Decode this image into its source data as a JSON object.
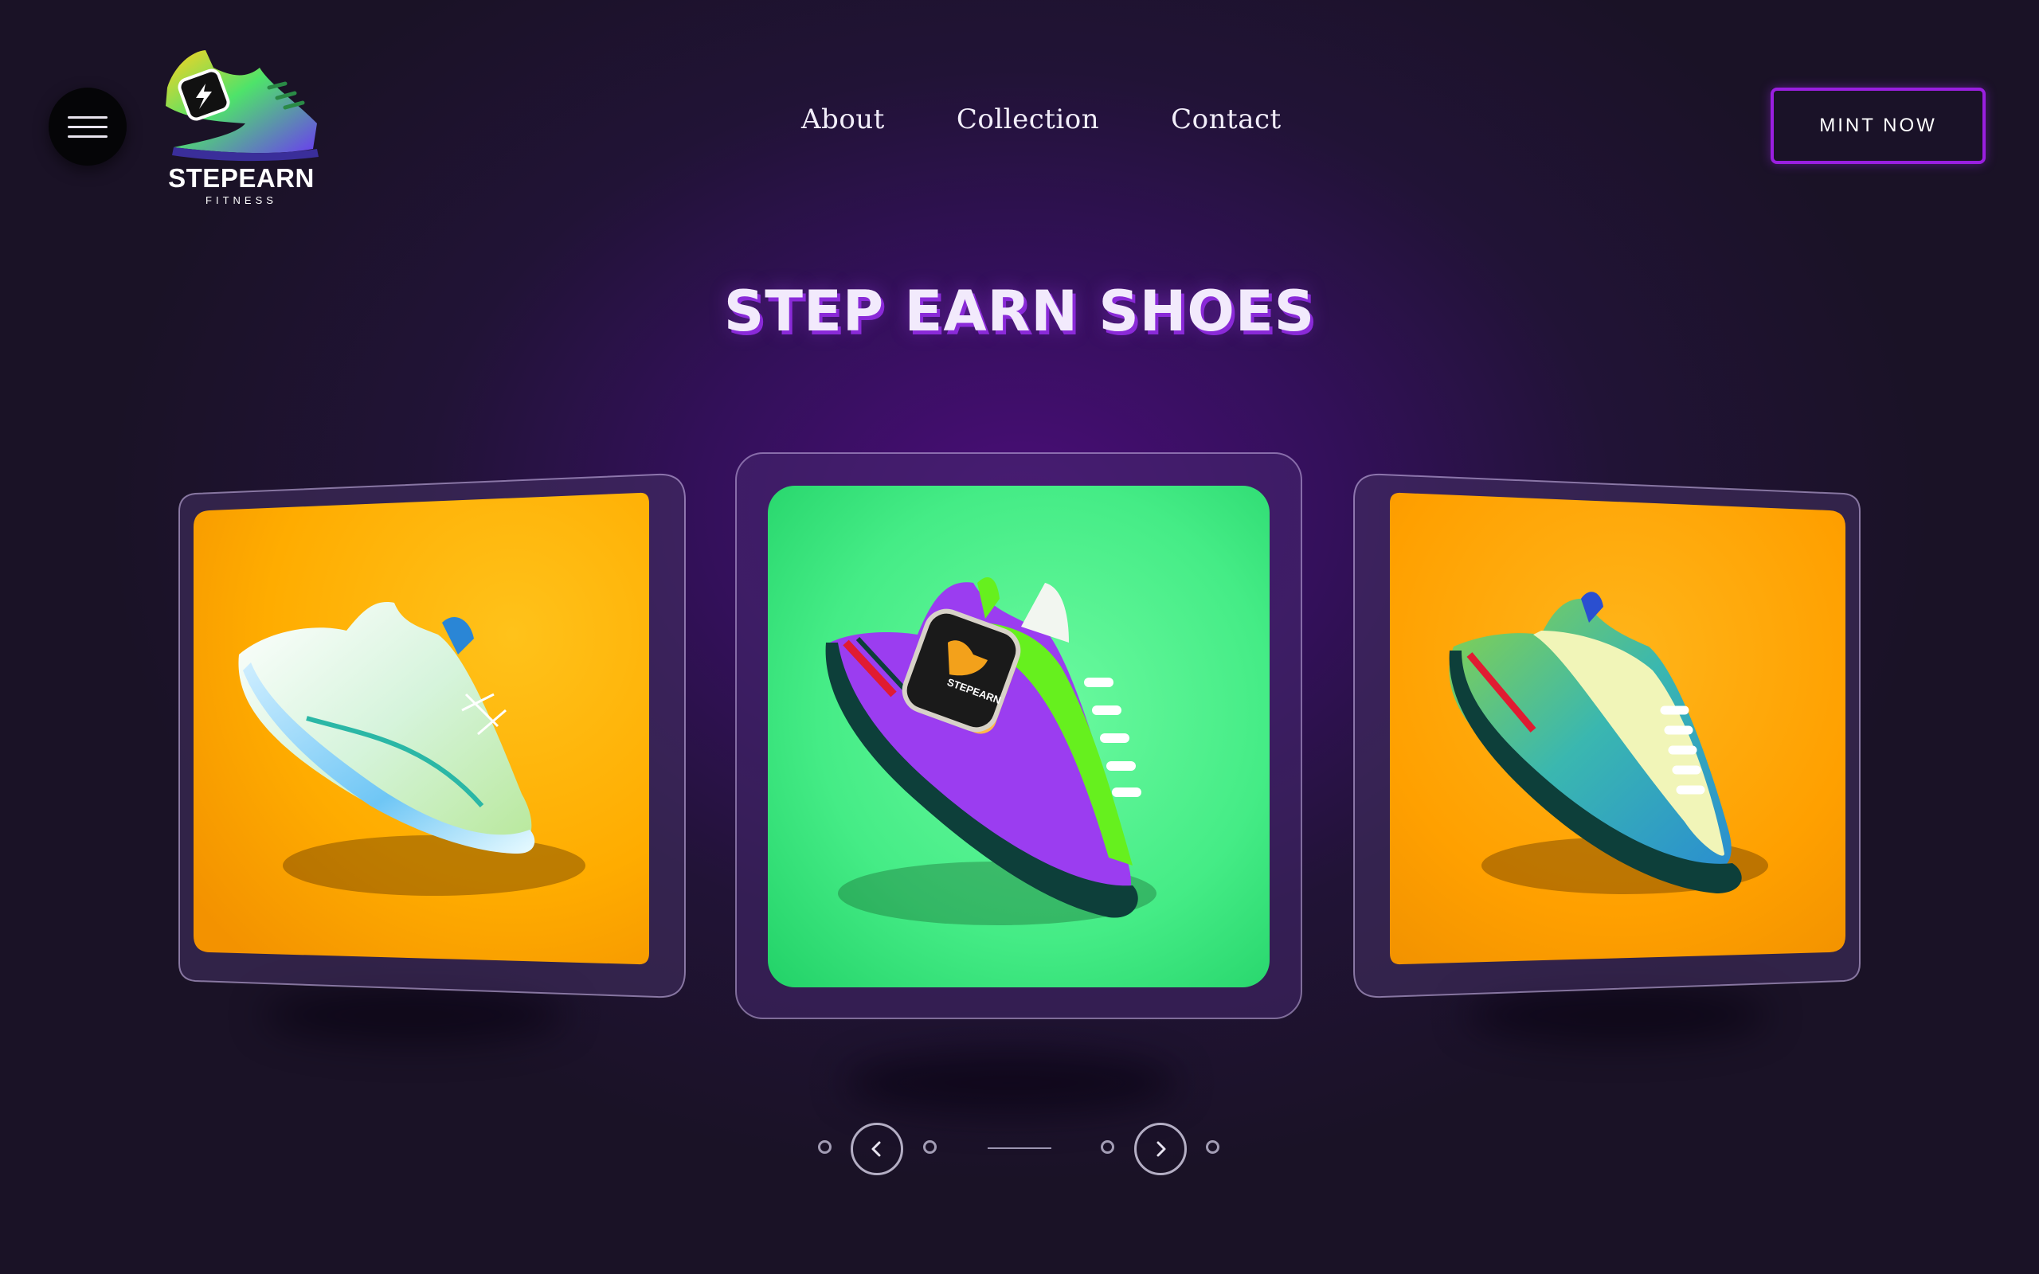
{
  "header": {
    "logo": {
      "brand": "STEPEARN",
      "subtitle": "FITNESS"
    },
    "nav": [
      {
        "label": "About"
      },
      {
        "label": "Collection"
      },
      {
        "label": "Contact"
      }
    ],
    "cta_label": "MINT NOW",
    "menu_icon": "hamburger-icon"
  },
  "hero": {
    "title": "STEP EARN SHOES"
  },
  "carousel": {
    "cards": [
      {
        "name": "white-mint-sneaker",
        "background": "#ffa500"
      },
      {
        "name": "purple-green-smartwatch-sneaker",
        "background": "#34e27a",
        "active": true
      },
      {
        "name": "green-yellow-sneaker",
        "background": "#ffa500"
      }
    ],
    "controls": {
      "prev_icon": "chevron-left-icon",
      "next_icon": "chevron-right-icon"
    }
  },
  "colors": {
    "accent": "#9a1fe0",
    "title_shadow": "#8a2ad8",
    "background": "#211336"
  }
}
